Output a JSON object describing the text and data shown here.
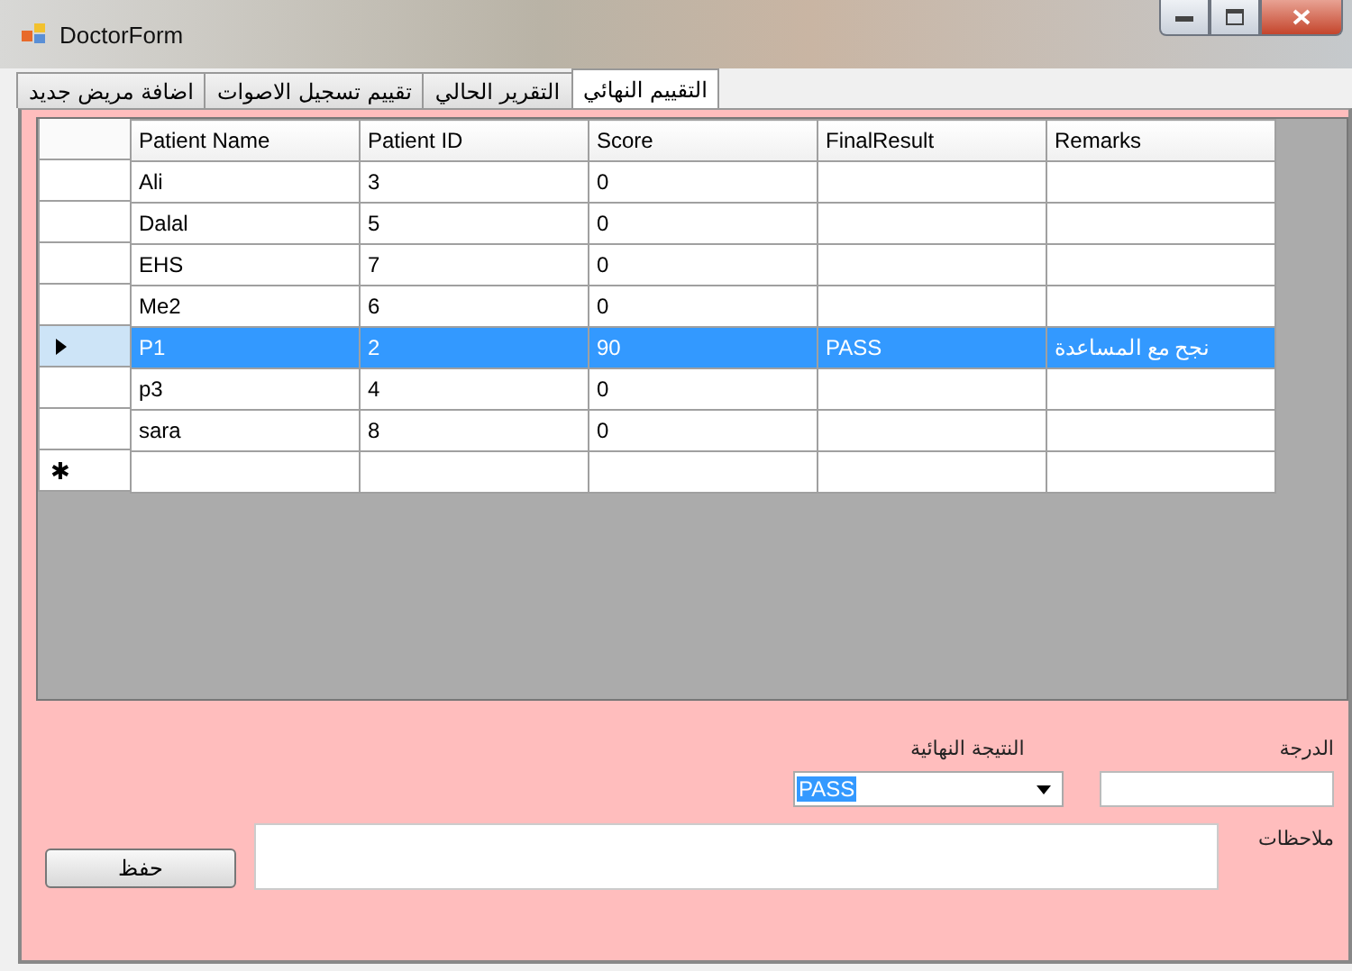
{
  "window": {
    "title": "DoctorForm"
  },
  "tabs": [
    {
      "label": "التقييم النهائي",
      "selected": true
    },
    {
      "label": "التقرير الحالي",
      "selected": false
    },
    {
      "label": "تقييم تسجيل الاصوات",
      "selected": false
    },
    {
      "label": "اضافة مريض جديد",
      "selected": false
    }
  ],
  "table": {
    "columns": [
      "Remarks",
      "FinalResult",
      "Score",
      "Patient ID",
      "Patient Name"
    ],
    "rows": [
      {
        "cells": [
          "",
          "",
          "0",
          "3",
          "Ali"
        ],
        "selected": false
      },
      {
        "cells": [
          "",
          "",
          "0",
          "5",
          "Dalal"
        ],
        "selected": false
      },
      {
        "cells": [
          "",
          "",
          "0",
          "7",
          "EHS"
        ],
        "selected": false
      },
      {
        "cells": [
          "",
          "",
          "0",
          "6",
          "Me2"
        ],
        "selected": false
      },
      {
        "cells": [
          "نجح مع المساعدة",
          "PASS",
          "90",
          "2",
          "P1"
        ],
        "selected": true
      },
      {
        "cells": [
          "",
          "",
          "0",
          "4",
          "p3"
        ],
        "selected": false
      },
      {
        "cells": [
          "",
          "",
          "0",
          "8",
          "sara"
        ],
        "selected": false
      }
    ],
    "new_row_marker": "✱"
  },
  "form": {
    "score_label": "الدرجة",
    "final_result_label": "النتيجة النهائية",
    "final_result_value": "PASS",
    "remarks_label": "ملاحظات",
    "save_button": "حفظ"
  }
}
